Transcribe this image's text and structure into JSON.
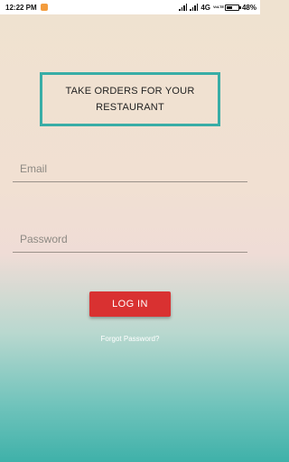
{
  "status_bar": {
    "time": "12:22 PM",
    "network": "4G",
    "volte": "VoLTE",
    "battery_percent": "48%",
    "battery_level": 0.48
  },
  "header": {
    "title": "TAKE ORDERS FOR YOUR RESTAURANT"
  },
  "form": {
    "email_placeholder": "Email",
    "email_value": "",
    "password_placeholder": "Password",
    "password_value": ""
  },
  "actions": {
    "login_label": "LOG IN",
    "forgot_label": "Forgot Password?"
  },
  "colors": {
    "accent_border": "#38ada6",
    "login_button": "#d93131"
  }
}
